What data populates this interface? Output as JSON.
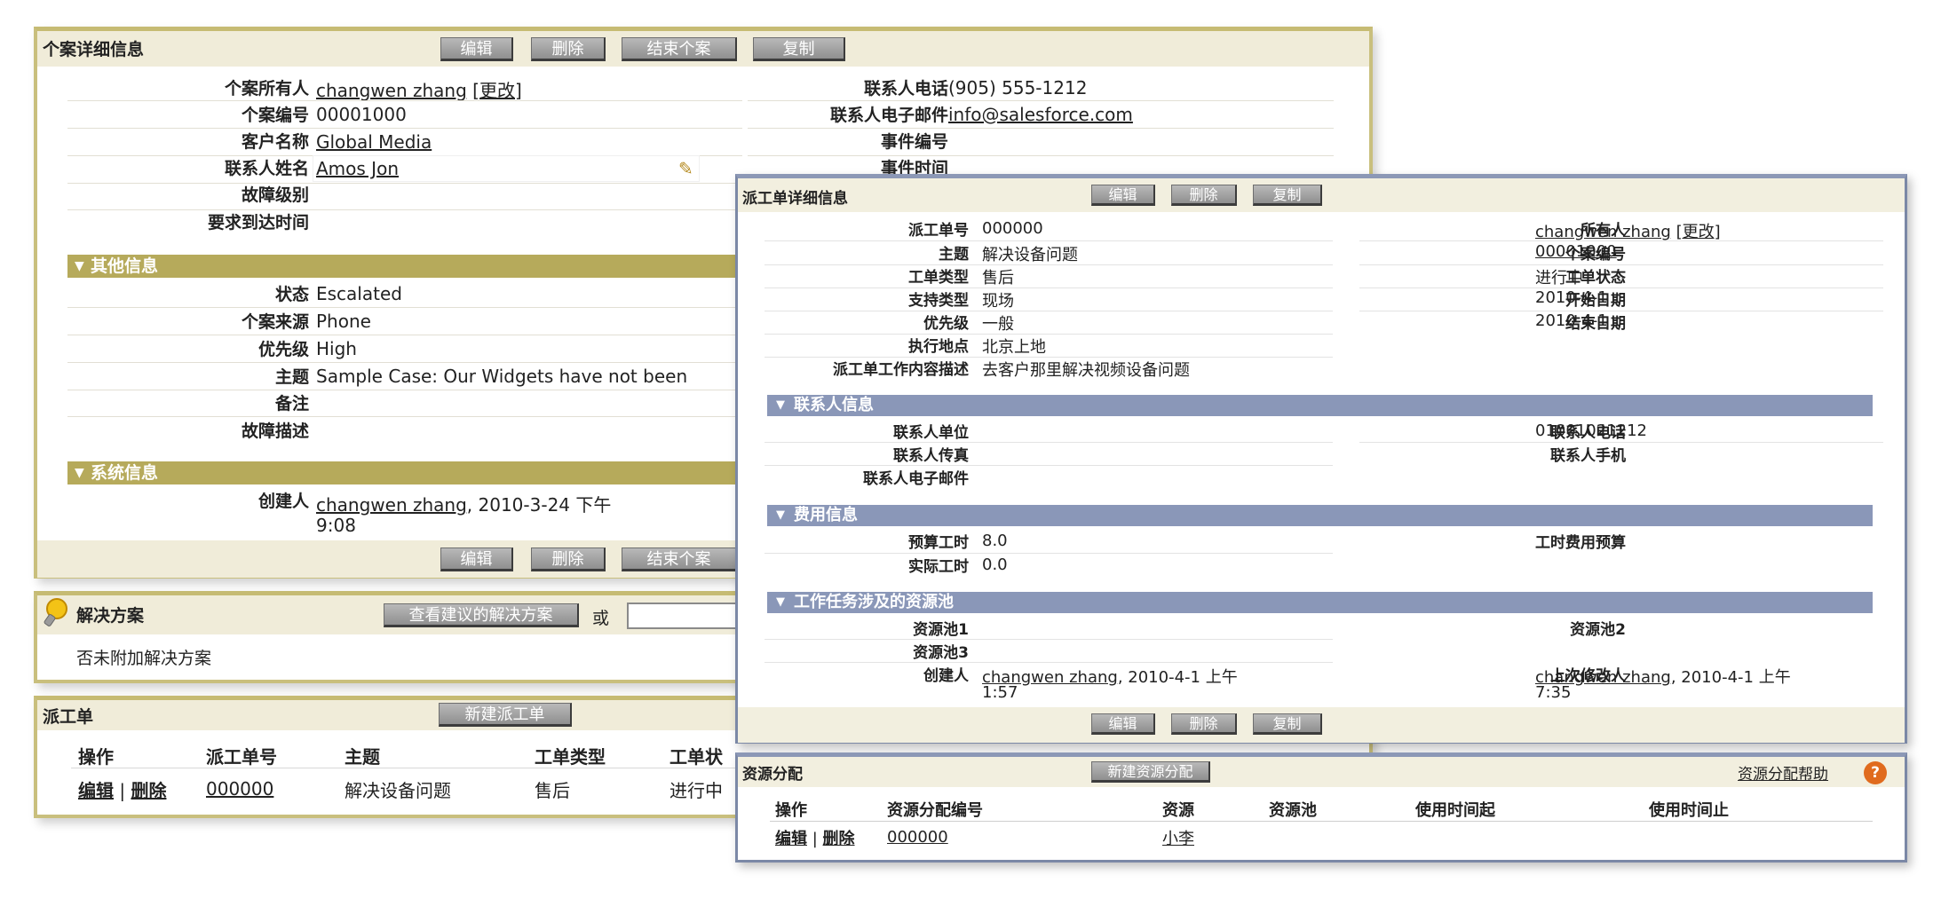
{
  "case": {
    "title": "个案详细信息",
    "buttons": {
      "edit": "编辑",
      "delete": "删除",
      "close": "结束个案",
      "copy": "复制"
    },
    "left_fields": [
      {
        "label": "个案所有人",
        "value": "changwen zhang",
        "extra": "[更改]"
      },
      {
        "label": "个案编号",
        "value": "00001000"
      },
      {
        "label": "客户名称",
        "value": "Global Media"
      },
      {
        "label": "联系人姓名",
        "value": "Amos Jon"
      },
      {
        "label": "故障级别",
        "value": ""
      },
      {
        "label": "要求到达时间",
        "value": ""
      }
    ],
    "right_fields": [
      {
        "label": "联系人电话",
        "value": "(905) 555-1212"
      },
      {
        "label": "联系人电子邮件",
        "value": "info@salesforce.com"
      },
      {
        "label": "事件编号",
        "value": ""
      },
      {
        "label": "事件时间",
        "value": ""
      }
    ],
    "other_section": "其他信息",
    "other_fields": [
      {
        "label": "状态",
        "value": "Escalated"
      },
      {
        "label": "个案来源",
        "value": "Phone"
      },
      {
        "label": "优先级",
        "value": "High"
      },
      {
        "label": "主题",
        "value": "Sample Case: Our Widgets have not been"
      },
      {
        "label": "备注",
        "value": ""
      },
      {
        "label": "故障描述",
        "value": ""
      }
    ],
    "system_section": "系统信息",
    "creator_label": "创建人",
    "creator_name": "changwen zhang",
    "creator_time": ", 2010-3-24 下午",
    "creator_time2": "9:08"
  },
  "solution": {
    "title": "解决方案",
    "button": "查看建议的解决方案",
    "or": "或",
    "empty": "否未附加解决方案"
  },
  "dispatch": {
    "title": "派工单",
    "new_button": "新建派工单",
    "columns": [
      "操作",
      "派工单号",
      "主题",
      "工单类型",
      "工单状"
    ],
    "row": {
      "edit": "编辑",
      "sep": "|",
      "del": "删除",
      "number": "000000",
      "subject": "解决设备问题",
      "type": "售后",
      "status": "进行中"
    }
  },
  "workorder": {
    "title": "派工单详细信息",
    "buttons": {
      "edit": "编辑",
      "delete": "删除",
      "copy": "复制"
    },
    "left_fields": [
      {
        "label": "派工单号",
        "value": "000000"
      },
      {
        "label": "主题",
        "value": "解决设备问题"
      },
      {
        "label": "工单类型",
        "value": "售后"
      },
      {
        "label": "支持类型",
        "value": "现场"
      },
      {
        "label": "优先级",
        "value": "一般"
      },
      {
        "label": "执行地点",
        "value": "北京上地"
      },
      {
        "label": "派工单工作内容描述",
        "value": "去客户那里解决视频设备问题"
      }
    ],
    "right_fields": [
      {
        "label": "所有人",
        "value": "changwen zhang",
        "extra": "[更改]"
      },
      {
        "label": "个案编号",
        "value": "00001000"
      },
      {
        "label": "工单状态",
        "value": "进行中"
      },
      {
        "label": "开始日期",
        "value": "2010-4-1"
      },
      {
        "label": "结束日期",
        "value": "2010-4-1"
      }
    ],
    "contact_section": "联系人信息",
    "contact_left": [
      {
        "label": "联系人单位",
        "value": ""
      },
      {
        "label": "联系人传真",
        "value": ""
      },
      {
        "label": "联系人电子邮件",
        "value": ""
      }
    ],
    "contact_right": [
      {
        "label": "联系人电话",
        "value": "01001021212"
      },
      {
        "label": "联系人手机",
        "value": ""
      }
    ],
    "cost_section": "费用信息",
    "cost_left": [
      {
        "label": "预算工时",
        "value": "8.0"
      },
      {
        "label": "实际工时",
        "value": "0.0"
      }
    ],
    "cost_right": [
      {
        "label": "工时费用预算",
        "value": ""
      }
    ],
    "pool_section": "工作任务涉及的资源池",
    "pool_fields": [
      {
        "label": "资源池1",
        "value": ""
      },
      {
        "label": "资源池2",
        "value": ""
      },
      {
        "label": "资源池3",
        "value": ""
      }
    ],
    "created_label": "创建人",
    "created_name": "changwen zhang",
    "created_time": ", 2010-4-1 上午",
    "created_time2": "1:57",
    "modified_label": "上次修改人",
    "modified_name": "changwen zhang",
    "modified_time": ", 2010-4-1 上午",
    "modified_time2": "7:35"
  },
  "resource": {
    "title": "资源分配",
    "new_button": "新建资源分配",
    "help": "资源分配帮助",
    "help_icon": "?",
    "columns": [
      "操作",
      "资源分配编号",
      "资源",
      "资源池",
      "使用时间起",
      "使用时间止"
    ],
    "row": {
      "edit": "编辑",
      "sep": "|",
      "del": "删除",
      "number": "000000",
      "resource": "小李"
    }
  }
}
